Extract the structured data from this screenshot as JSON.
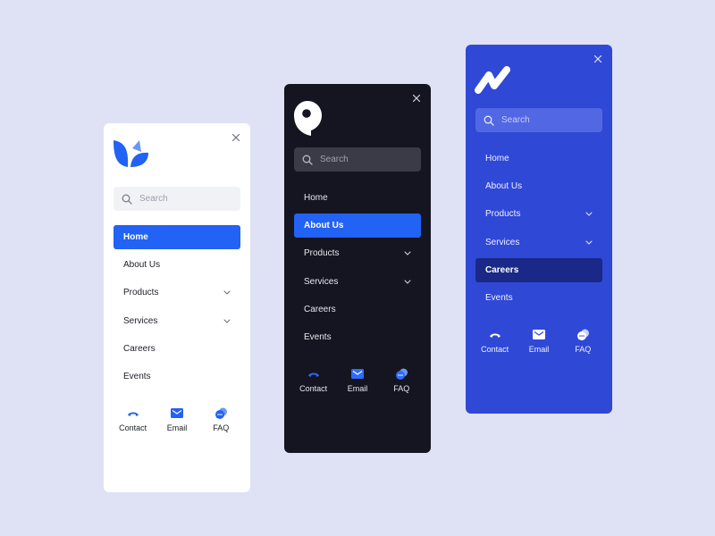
{
  "colors": {
    "background": "#dfe2f5",
    "accent_blue": "#2262f4",
    "dark_panel": "#141521",
    "blue_panel": "#3048d6",
    "blue_active": "#1a2888"
  },
  "panels": [
    {
      "theme": "light",
      "logo": "leaf-logo-icon",
      "close_icon": "close-icon",
      "search": {
        "placeholder": "Search",
        "icon": "search-icon"
      },
      "menu": [
        {
          "label": "Home",
          "active": true,
          "has_submenu": false
        },
        {
          "label": "About Us",
          "active": false,
          "has_submenu": false
        },
        {
          "label": "Products",
          "active": false,
          "has_submenu": true
        },
        {
          "label": "Services",
          "active": false,
          "has_submenu": true
        },
        {
          "label": "Careers",
          "active": false,
          "has_submenu": false
        },
        {
          "label": "Events",
          "active": false,
          "has_submenu": false
        }
      ],
      "footer": [
        {
          "label": "Contact",
          "icon": "phone-icon"
        },
        {
          "label": "Email",
          "icon": "mail-icon"
        },
        {
          "label": "FAQ",
          "icon": "chat-icon"
        }
      ]
    },
    {
      "theme": "dark",
      "logo": "pin-logo-icon",
      "close_icon": "close-icon",
      "search": {
        "placeholder": "Search",
        "icon": "search-icon"
      },
      "menu": [
        {
          "label": "Home",
          "active": false,
          "has_submenu": false
        },
        {
          "label": "About Us",
          "active": true,
          "has_submenu": false
        },
        {
          "label": "Products",
          "active": false,
          "has_submenu": true
        },
        {
          "label": "Services",
          "active": false,
          "has_submenu": true
        },
        {
          "label": "Careers",
          "active": false,
          "has_submenu": false
        },
        {
          "label": "Events",
          "active": false,
          "has_submenu": false
        }
      ],
      "footer": [
        {
          "label": "Contact",
          "icon": "phone-icon"
        },
        {
          "label": "Email",
          "icon": "mail-icon"
        },
        {
          "label": "FAQ",
          "icon": "chat-icon"
        }
      ]
    },
    {
      "theme": "blue",
      "logo": "wave-logo-icon",
      "close_icon": "close-icon",
      "search": {
        "placeholder": "Search",
        "icon": "search-icon"
      },
      "menu": [
        {
          "label": "Home",
          "active": false,
          "has_submenu": false
        },
        {
          "label": "About Us",
          "active": false,
          "has_submenu": false
        },
        {
          "label": "Products",
          "active": false,
          "has_submenu": true
        },
        {
          "label": "Services",
          "active": false,
          "has_submenu": true
        },
        {
          "label": "Careers",
          "active": true,
          "has_submenu": false
        },
        {
          "label": "Events",
          "active": false,
          "has_submenu": false
        }
      ],
      "footer": [
        {
          "label": "Contact",
          "icon": "phone-icon"
        },
        {
          "label": "Email",
          "icon": "mail-icon"
        },
        {
          "label": "FAQ",
          "icon": "chat-icon"
        }
      ]
    }
  ]
}
